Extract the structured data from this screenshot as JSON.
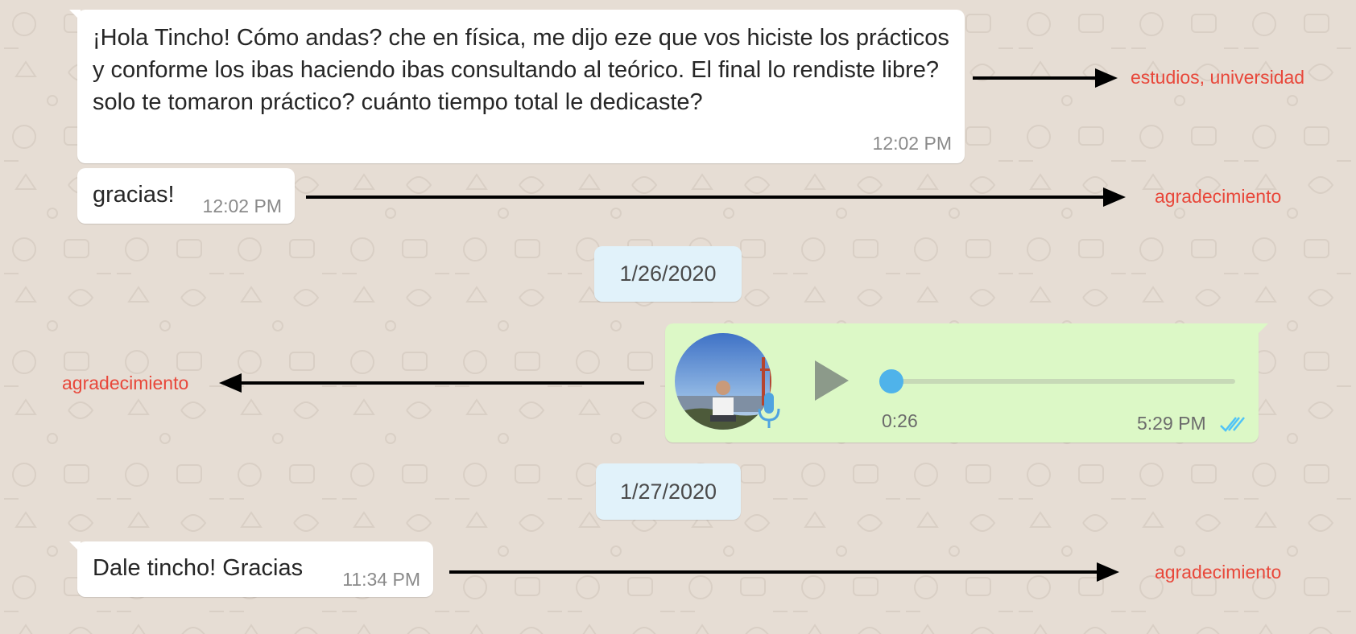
{
  "messages": [
    {
      "text": "¡Hola Tincho! Cómo andas? che en física, me dijo eze que vos hiciste los prácticos y conforme los ibas haciendo ibas consultando al teórico. El final lo rendiste libre? solo te tomaron práctico? cuánto tiempo total le dedicaste?",
      "time": "12:02 PM",
      "label": "estudios, universidad"
    },
    {
      "text": "gracias!",
      "time": "12:02 PM",
      "label": "agradecimiento"
    },
    {
      "text": "Dale tincho! Gracias",
      "time": "11:34 PM",
      "label": "agradecimiento"
    }
  ],
  "dates": [
    "1/26/2020",
    "1/27/2020"
  ],
  "voice_message": {
    "duration": "0:26",
    "time": "5:29 PM",
    "label": "agradecimiento",
    "status_icon": "double-check-read-icon",
    "progress": 0
  },
  "colors": {
    "label": "#e8473a",
    "outgoing": "#dcf8c6",
    "incoming": "#ffffff",
    "date_pill": "#e1f2fa",
    "read_check": "#4fc3f7",
    "background": "#e6ddd4"
  }
}
